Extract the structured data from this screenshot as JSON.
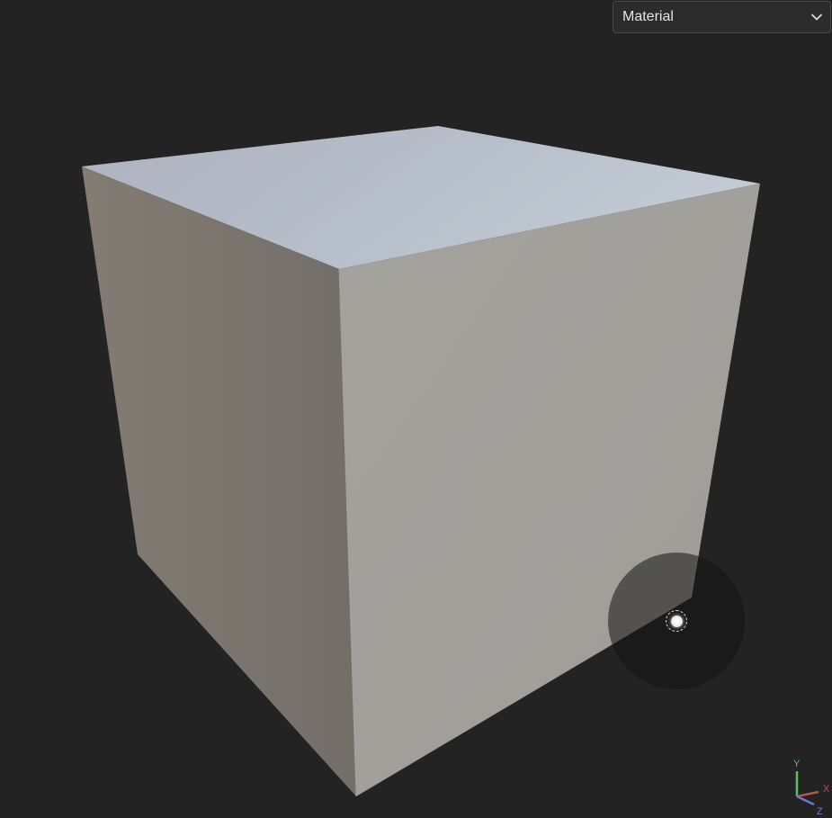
{
  "material_dropdown": {
    "selected": "Material",
    "icon": "chevron-down-icon"
  },
  "scene": {
    "object": "cube",
    "colors": {
      "background": "#232323",
      "top_face": "#b8c0cb",
      "left_face": "#7a756e",
      "front_face": "#a3a19c"
    }
  },
  "light_control": {
    "icon": "light-source-icon"
  },
  "axis_gizmo": {
    "y_label": "Y",
    "x_label": "X",
    "z_label": "Z",
    "colors": {
      "x": "#b4564f",
      "y": "#5fbf5a",
      "z": "#6f72d6"
    }
  }
}
